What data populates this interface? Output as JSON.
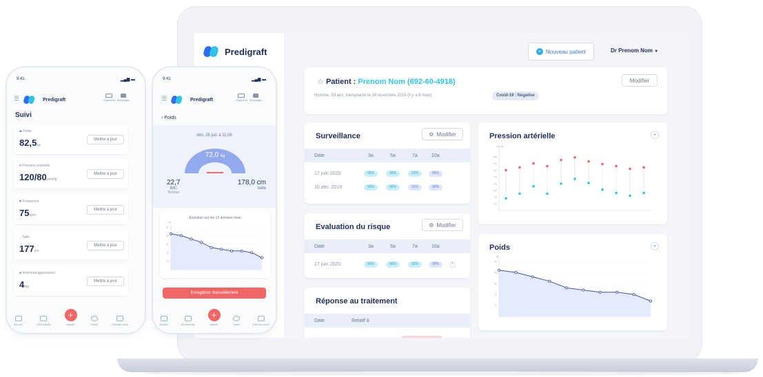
{
  "laptop": {
    "brand": "Predigraft",
    "new_patient": "Nouveau patient",
    "doctor": "Dr Prenom Nom",
    "patient": {
      "label": "Patient :",
      "name": "Prenom Nom (692-60-4918)",
      "details": "Homme, 59 ans, transplanté le 26 novembre 2019 (il y a 6 mois)",
      "covid": "Covid-19 : Negative",
      "edit": "Modifier"
    },
    "surveillance": {
      "title": "Surveillance",
      "edit": "Modifier",
      "headers": [
        "Date",
        "3a",
        "5a",
        "7a",
        "10a"
      ],
      "rows": [
        {
          "date": "17 juin 2020",
          "v": [
            "96%",
            "96%",
            "92%",
            "88%"
          ]
        },
        {
          "date": "10 déc. 2019",
          "v": [
            "96%",
            "96%",
            "91%",
            "88%"
          ]
        }
      ]
    },
    "risque": {
      "title": "Evaluation du risque",
      "edit": "Modifier",
      "headers": [
        "Date",
        "3a",
        "5a",
        "7a",
        "10a"
      ],
      "rows": [
        {
          "date": "17 juin 2020",
          "v": [
            "96%",
            "96%",
            "92%",
            "88%"
          ]
        }
      ]
    },
    "reponse": {
      "title": "Réponse au traitement",
      "headers": [
        "Date",
        "Relatif à"
      ]
    },
    "pression_title": "Pression artérielle",
    "poids_title": "Poids",
    "colors": {
      "accent": "#2fc4e6",
      "brand": "#2e6ff2",
      "red": "#f06666",
      "navy": "#1f2d5a"
    }
  },
  "phone1": {
    "time": "9:41",
    "brand": "Predigraft",
    "hdr_icons": [
      "Urgences",
      "Messages"
    ],
    "title": "Suivi",
    "items": [
      {
        "label": "Poids",
        "value": "82,5",
        "unit": "kg",
        "btn": "Mettre à jour"
      },
      {
        "label": "Pression artérielle",
        "value": "120/80",
        "unit": "mmHg",
        "btn": "Mettre à jour"
      },
      {
        "label": "Fréquence",
        "value": "75",
        "unit": "bpm",
        "btn": "Mettre à jour"
      },
      {
        "label": "Taille",
        "value": "177",
        "unit": "cm",
        "btn": "Mettre à jour"
      },
      {
        "label": "Immunosuppresseurs",
        "value": "4",
        "unit": "mg",
        "btn": "Mettre à jour"
      }
    ],
    "nav": [
      "Accueil",
      "Documents",
      "Ajouter",
      "Santé",
      "Rendez-vous"
    ]
  },
  "phone2": {
    "time": "9:41",
    "brand": "Predigraft",
    "hdr_icons": [
      "Urgences",
      "Messages"
    ],
    "back": "Poids",
    "date": "dim. 26 juil. à 11:06",
    "gauge_value": "72,0",
    "gauge_unit": "kg",
    "imc_value": "22,7",
    "imc_label": "IMC",
    "imc_status": "Normal",
    "taille_value": "178,0 cm",
    "taille_label": "taille",
    "chart_title": "Évolution sur les 12 derniers mois",
    "save": "Enregistrer manuellement",
    "nav": [
      "Accueil",
      "Documents",
      "Ajouter",
      "Santé",
      "Rendez-vous"
    ]
  },
  "chart_data": [
    {
      "type": "line",
      "title": "Poids",
      "xlabel": "",
      "ylabel": "kg",
      "x": [
        1,
        2,
        3,
        4,
        5,
        6,
        7,
        8,
        9,
        10
      ],
      "series": [
        {
          "values": [
            86,
            85,
            83,
            81,
            78,
            77,
            76,
            76,
            75,
            72
          ]
        }
      ],
      "ylim": [
        65,
        90
      ],
      "grid": true
    },
    {
      "type": "scatter",
      "title": "Pression artérielle",
      "ylabel": "mmHg",
      "x": [
        1,
        2,
        3,
        4,
        5,
        6,
        7,
        8,
        9,
        10,
        11
      ],
      "series": [
        {
          "values": [
            130,
            134,
            140,
            136,
            145,
            149,
            143,
            139,
            136,
            132,
            134
          ]
        },
        {
          "values": [
            88,
            95,
            106,
            95,
            110,
            117,
            111,
            101,
            96,
            92,
            96
          ]
        }
      ],
      "ylim": [
        70,
        160
      ]
    },
    {
      "type": "line",
      "title": "Évolution sur les 12 derniers mois",
      "xlabel": "",
      "ylabel": "kg",
      "x": [
        1,
        2,
        3,
        4,
        5,
        6,
        7,
        8,
        9,
        10
      ],
      "series": [
        {
          "values": [
            86,
            85,
            83,
            81,
            78,
            77,
            76,
            76,
            75,
            72
          ]
        }
      ],
      "ylim": [
        65,
        90
      ],
      "grid": true
    }
  ]
}
